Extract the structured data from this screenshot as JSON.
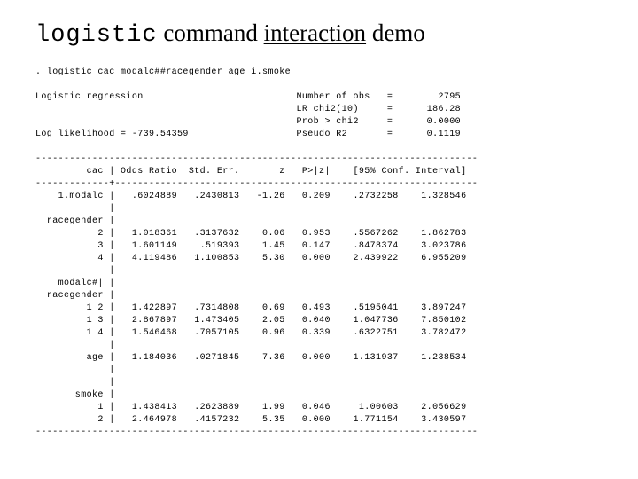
{
  "title": {
    "w1_mono": "logistic",
    "w2": " command ",
    "w3_ul": "interaction",
    "w4": " demo"
  },
  "cmd_line": ". logistic cac modalc##racegender age i.smoke",
  "header": {
    "label": "Logistic regression",
    "ll_label": "Log likelihood = -739.54359",
    "stats": [
      {
        "name": "Number of obs",
        "val": "2795"
      },
      {
        "name": "LR chi2(10)",
        "val": "186.28"
      },
      {
        "name": "Prob > chi2",
        "val": "0.0000"
      },
      {
        "name": "Pseudo R2",
        "val": "0.1119"
      }
    ]
  },
  "cols": {
    "dv": "cac",
    "c1": "Odds Ratio",
    "c2": "Std. Err.",
    "c3": "z",
    "c4": "P>|z|",
    "c5": "[95% Conf. Interval]"
  },
  "rows": [
    {
      "name": "1.modalc",
      "or": ".6024889",
      "se": ".2430813",
      "z": "-1.26",
      "p": "0.209",
      "lo": ".2732258",
      "hi": "1.328546"
    },
    {
      "section": "racegender"
    },
    {
      "name": "2",
      "or": "1.018361",
      "se": ".3137632",
      "z": "0.06",
      "p": "0.953",
      "lo": ".5567262",
      "hi": "1.862783"
    },
    {
      "name": "3",
      "or": "1.601149",
      "se": ".519393",
      "z": "1.45",
      "p": "0.147",
      "lo": ".8478374",
      "hi": "3.023786"
    },
    {
      "name": "4",
      "or": "4.119486",
      "se": "1.100853",
      "z": "5.30",
      "p": "0.000",
      "lo": "2.439922",
      "hi": "6.955209"
    },
    {
      "section": "modalc#|"
    },
    {
      "section2": "racegender"
    },
    {
      "name": "1 2",
      "or": "1.422897",
      "se": ".7314808",
      "z": "0.69",
      "p": "0.493",
      "lo": ".5195041",
      "hi": "3.897247"
    },
    {
      "name": "1 3",
      "or": "2.867897",
      "se": "1.473405",
      "z": "2.05",
      "p": "0.040",
      "lo": "1.047736",
      "hi": "7.850102"
    },
    {
      "name": "1 4",
      "or": "1.546468",
      "se": ".7057105",
      "z": "0.96",
      "p": "0.339",
      "lo": ".6322751",
      "hi": "3.782472"
    },
    {
      "solo": "age",
      "or": "1.184036",
      "se": ".0271845",
      "z": "7.36",
      "p": "0.000",
      "lo": "1.131937",
      "hi": "1.238534"
    },
    {
      "section": "smoke"
    },
    {
      "name": "1",
      "or": "1.438413",
      "se": ".2623889",
      "z": "1.99",
      "p": "0.046",
      "lo": "1.00603",
      "hi": "2.056629"
    },
    {
      "name": "2",
      "or": "2.464978",
      "se": ".4157232",
      "z": "5.35",
      "p": "0.000",
      "lo": "1.771154",
      "hi": "3.430597"
    }
  ]
}
